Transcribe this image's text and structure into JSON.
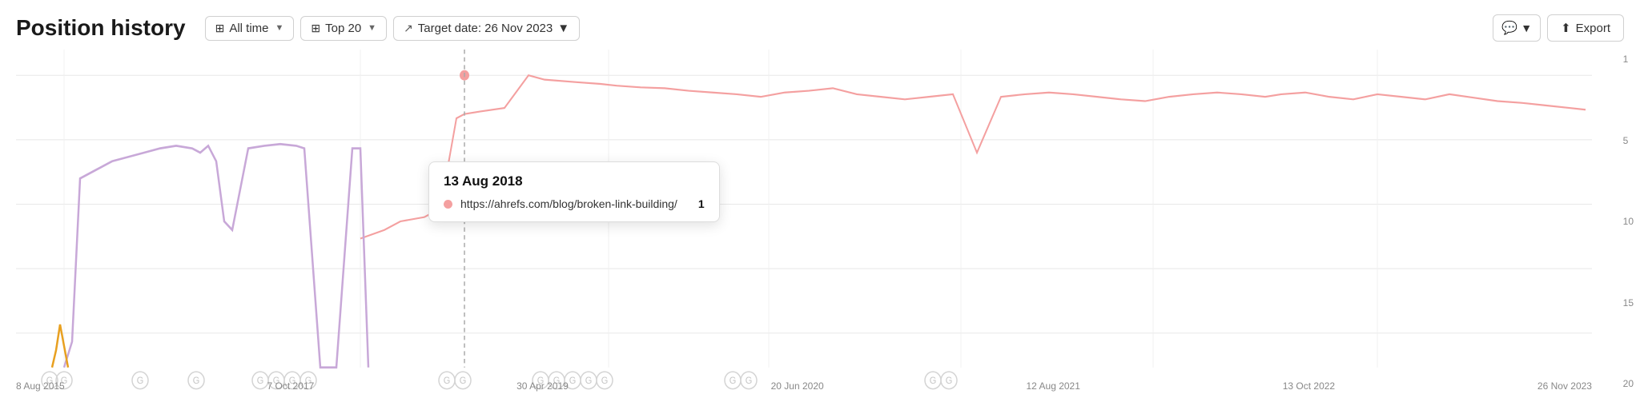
{
  "header": {
    "title": "Position history",
    "buttons": {
      "all_time": "All time",
      "top_20": "Top 20",
      "target_date": "Target date: 26 Nov 2023"
    },
    "export_label": "Export"
  },
  "y_axis": {
    "labels": [
      "1",
      "5",
      "10",
      "15",
      "20"
    ]
  },
  "x_axis": {
    "labels": [
      "8 Aug 2015",
      "7 Oct 2017",
      "30 Apr 2019",
      "20 Jun 2020",
      "12 Aug 2021",
      "13 Oct 2022",
      "26 Nov 2023"
    ]
  },
  "tooltip": {
    "date": "13 Aug 2018",
    "url": "https://ahrefs.com/blog/broken-link-building/",
    "rank": "1"
  },
  "colors": {
    "pink_line": "#f4a0a0",
    "purple_line": "#c8a8d8",
    "orange_line": "#e8a020",
    "grid": "#e8e8e8",
    "cursor": "#aaaaaa"
  }
}
